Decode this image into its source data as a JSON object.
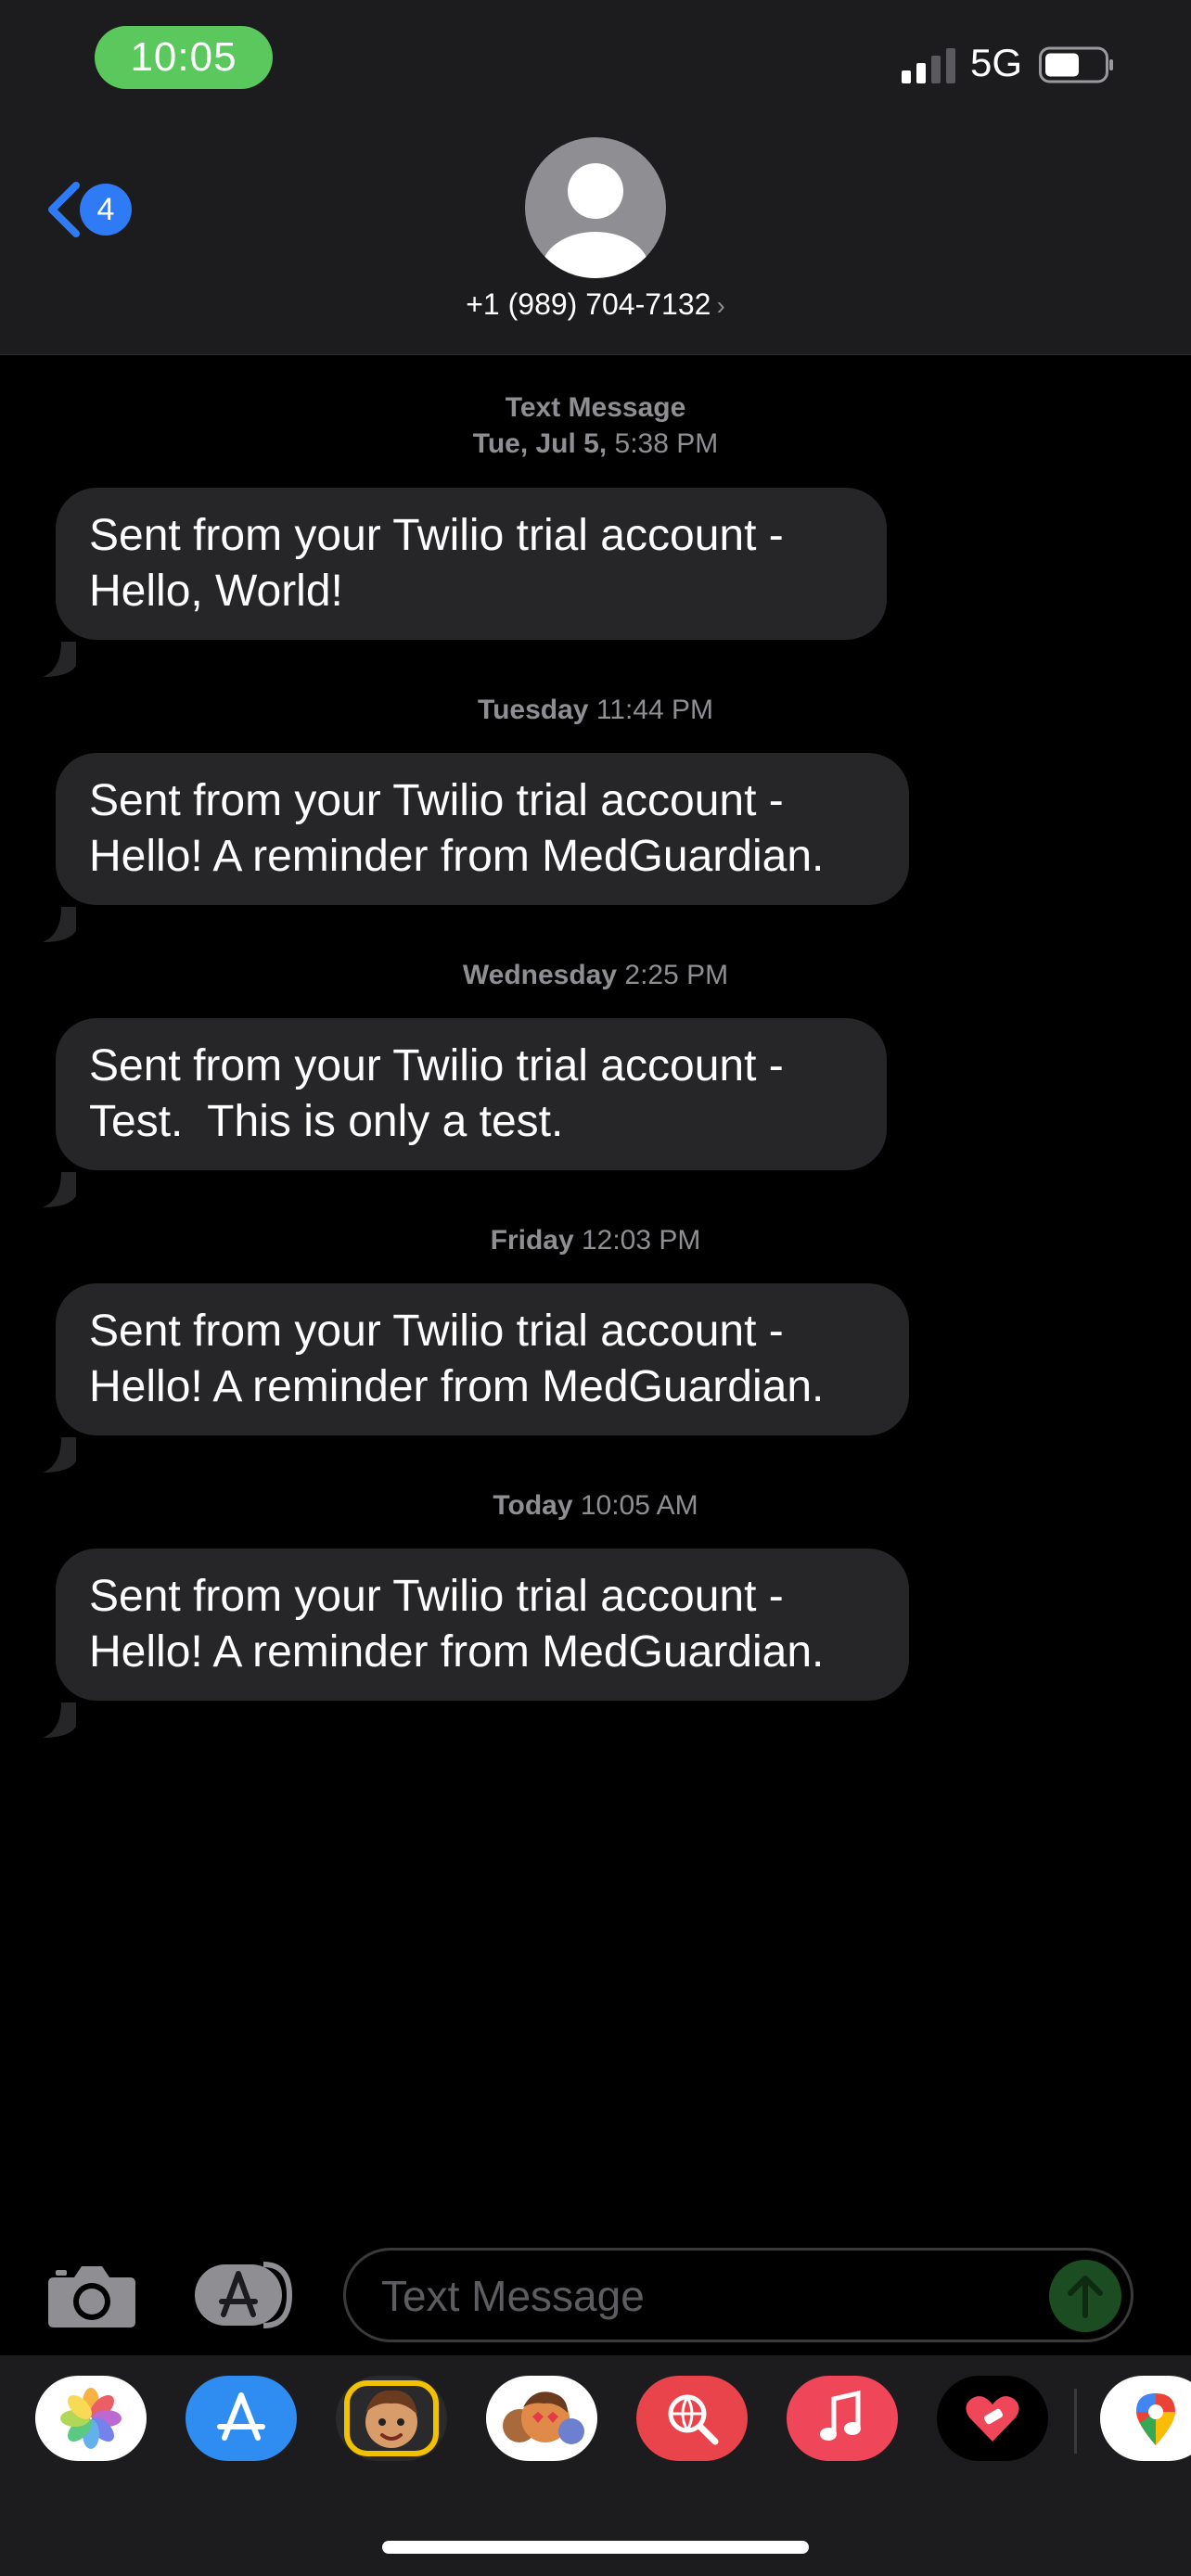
{
  "status_bar": {
    "time": "10:05",
    "network": "5G"
  },
  "header": {
    "back_badge": "4",
    "contact": "+1 (989) 704-7132",
    "chevron": "›"
  },
  "thread": {
    "items": [
      {
        "ts_bold": "Text Message",
        "ts_rest": ""
      },
      {
        "ts_bold": "Tue, Jul 5,",
        "ts_rest": " 5:38 PM"
      },
      {
        "line1": "Sent from your Twilio trial account -",
        "line2": "Hello, World!"
      },
      {
        "ts_bold": "Tuesday",
        "ts_rest": " 11:44 PM"
      },
      {
        "line1": "Sent from your Twilio trial account -",
        "line2": "Hello! A reminder from MedGuardian."
      },
      {
        "ts_bold": "Wednesday",
        "ts_rest": " 2:25 PM"
      },
      {
        "line1": "Sent from your Twilio trial account -",
        "line2": "Test.  This is only a test."
      },
      {
        "ts_bold": "Friday",
        "ts_rest": " 12:03 PM"
      },
      {
        "line1": "Sent from your Twilio trial account -",
        "line2": "Hello! A reminder from MedGuardian."
      },
      {
        "ts_bold": "Today",
        "ts_rest": " 10:05 AM"
      },
      {
        "line1": "Sent from your Twilio trial account -",
        "line2": "Hello! A reminder from MedGuardian."
      }
    ]
  },
  "compose": {
    "placeholder": "Text Message"
  },
  "app_strip": {
    "apps": [
      "photos-app",
      "app-store-app",
      "memoji-app",
      "animoji-app",
      "search-images-app",
      "music-app",
      "fitness-heart-app",
      "google-maps-app"
    ]
  },
  "colors": {
    "accent": "#2f7bf5",
    "status_pill": "#5ac85d",
    "bubble": "#262628",
    "send": "#1c4d22"
  }
}
